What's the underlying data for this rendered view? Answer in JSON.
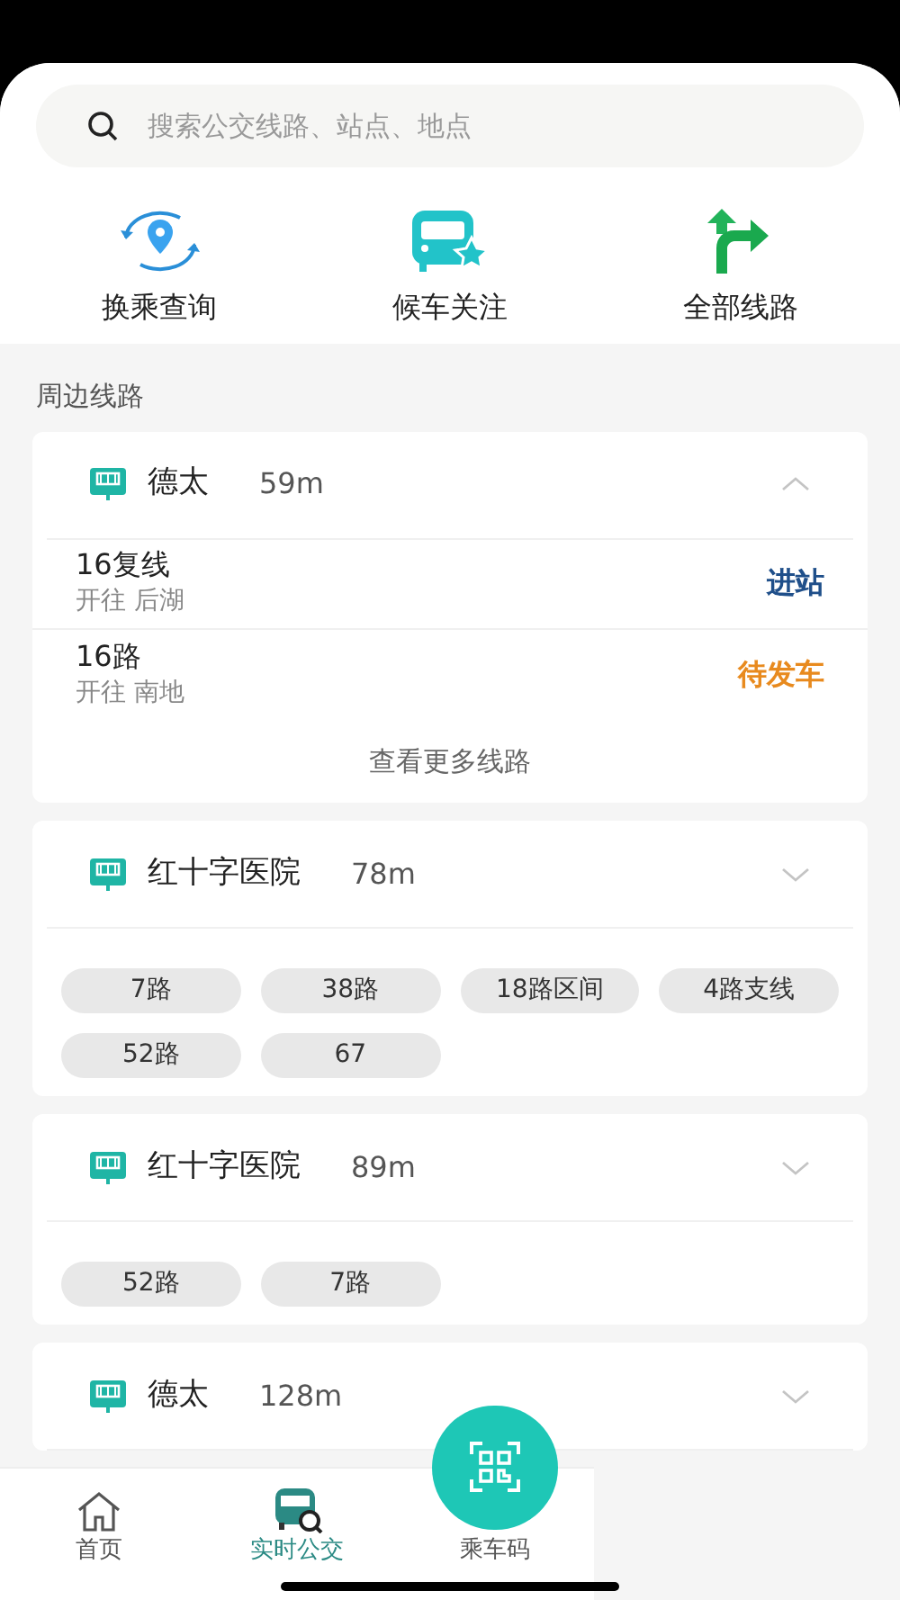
{
  "search": {
    "placeholder": "搜索公交线路、站点、地点"
  },
  "shortcuts": [
    {
      "kind": "transfer",
      "label": "换乘查询"
    },
    {
      "kind": "favorite",
      "label": "候车关注"
    },
    {
      "kind": "routes",
      "label": "全部线路"
    }
  ],
  "section_title": "周边线路",
  "stations": [
    {
      "name": "德太",
      "distance": "59m",
      "expanded": true,
      "kind": "list",
      "lines": [
        {
          "name": "16复线",
          "direction": "开往 后湖",
          "status": "进站",
          "color": "#1f4f8a"
        },
        {
          "name": "16路",
          "direction": "开往 南地",
          "status": "待发车",
          "color": "#e88a1e"
        }
      ],
      "more": "查看更多线路"
    },
    {
      "name": "红十字医院",
      "distance": "78m",
      "expanded": false,
      "kind": "chips",
      "chips": [
        "7路",
        "38路",
        "18路区间",
        "4路支线",
        "52路",
        "67"
      ]
    },
    {
      "name": "红十字医院",
      "distance": "89m",
      "expanded": false,
      "kind": "chips",
      "chips": [
        "52路",
        "7路"
      ]
    },
    {
      "name": "德太",
      "distance": "128m",
      "expanded": false,
      "kind": "chips"
    }
  ],
  "tabs": [
    {
      "kind": "home",
      "label": "首页",
      "selected": false
    },
    {
      "kind": "bus",
      "label": "实时公交",
      "selected": true
    },
    {
      "kind": "qr",
      "label": "乘车码",
      "selected": false
    }
  ]
}
